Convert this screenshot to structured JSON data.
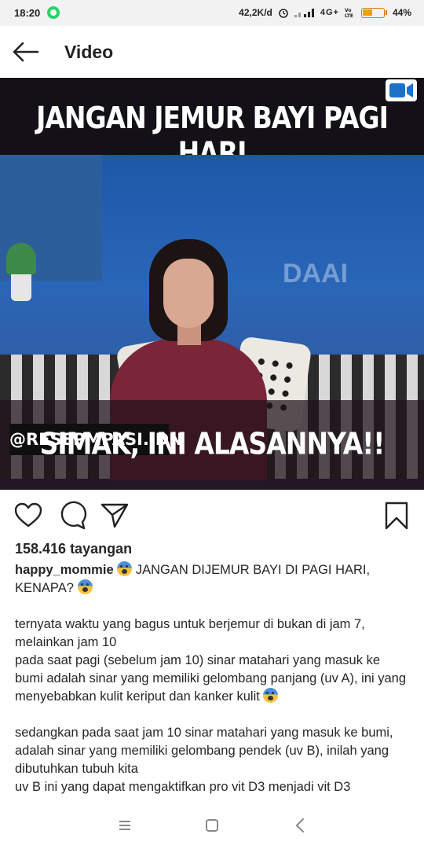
{
  "status_bar": {
    "time": "18:20",
    "speed": "42,2K/d",
    "network": "4G+",
    "battery": "44%",
    "battery_level": 0.44,
    "icons": [
      "whatsapp-icon",
      "alarm-icon",
      "signal-icon",
      "volte-icon",
      "battery-icon"
    ]
  },
  "app_bar": {
    "title": "Video",
    "back_icon": "arrow-left-icon"
  },
  "video": {
    "title_top": "JANGAN JEMUR BAYI PAGI HARI",
    "handle": "@RESEPMPASI.IDN",
    "title_bottom": "SIMAK, INI ALASANNYA!!",
    "badge_icon": "igtv-icon",
    "logo_text": "DAAI"
  },
  "actions": {
    "icons": [
      "heart-icon",
      "comment-icon",
      "share-icon",
      "bookmark-icon"
    ]
  },
  "post": {
    "views": "158.416 tayangan",
    "username": "happy_mommie",
    "headline": "JANGAN DIJEMUR BAYI DI PAGI HARI, KENAPA?",
    "lines": [
      "ternyata waktu yang bagus untuk berjemur di bukan di jam 7, melainkan jam 10",
      "pada saat pagi (sebelum jam 10) sinar matahari yang masuk ke bumi adalah sinar yang memiliki gelombang panjang (uv A), ini yang menyebabkan kulit keriput dan kanker kulit",
      "sedangkan pada saat jam 10 sinar matahari yang masuk ke bumi, adalah sinar yang memiliki gelombang pendek (uv B), inilah yang dibutuhkan tubuh kita",
      "uv B ini yang dapat mengaktifkan pro vit D3 menjadi vit D3"
    ],
    "emoji_icon": "screaming-face-icon"
  },
  "nav_bar": {
    "icons": [
      "menu-icon",
      "home-square-icon",
      "back-chevron-icon"
    ]
  }
}
